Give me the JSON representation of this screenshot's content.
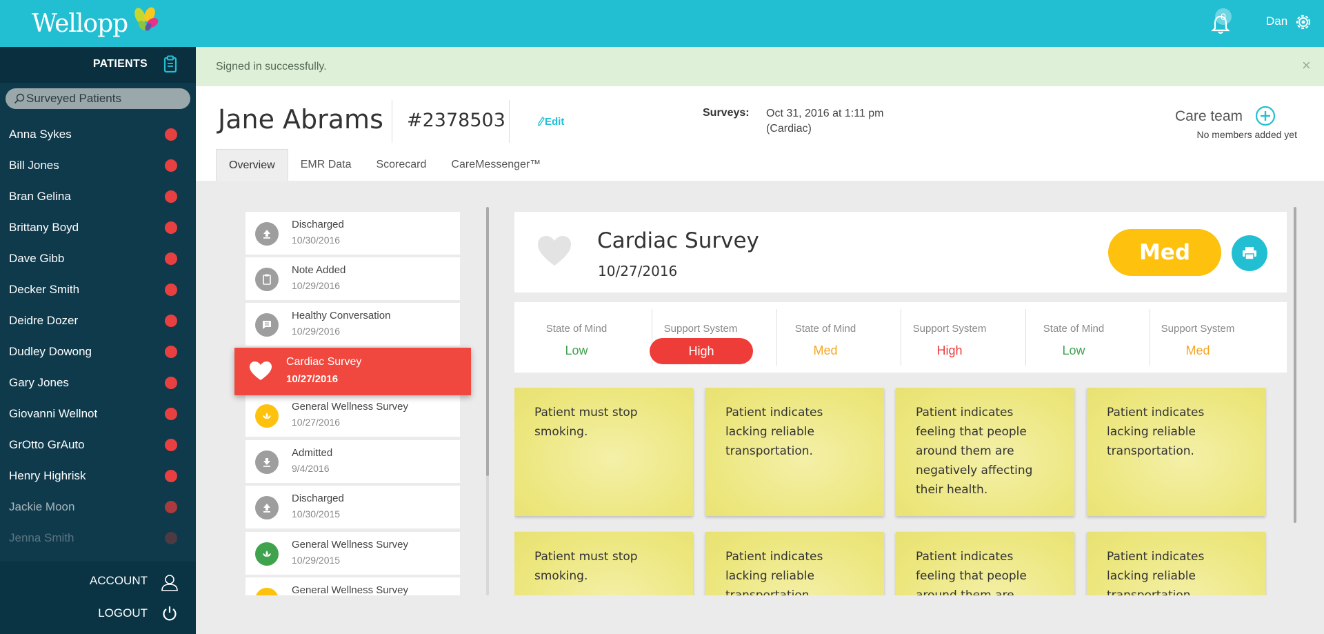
{
  "app": {
    "name": "Wellopp",
    "notification_count": "0",
    "user_name": "Dan"
  },
  "sidebar": {
    "header_label": "PATIENTS",
    "search_placeholder": "Surveyed Patients",
    "patients": [
      {
        "name": "Anna Sykes"
      },
      {
        "name": "Bill Jones"
      },
      {
        "name": "Bran Gelina"
      },
      {
        "name": "Brittany Boyd"
      },
      {
        "name": "Dave Gibb"
      },
      {
        "name": "Decker Smith"
      },
      {
        "name": "Deidre Dozer"
      },
      {
        "name": "Dudley Dowong"
      },
      {
        "name": "Gary Jones"
      },
      {
        "name": "Giovanni Wellnot"
      },
      {
        "name": "GrOtto GrAuto"
      },
      {
        "name": "Henry Highrisk"
      },
      {
        "name": "Jackie Moon"
      },
      {
        "name": "Jenna Smith"
      }
    ],
    "account_label": "ACCOUNT",
    "logout_label": "LOGOUT"
  },
  "alert": {
    "message": "Signed in successfully.",
    "close_symbol": "×"
  },
  "patient": {
    "name": "Jane Abrams",
    "id": "#2378503",
    "edit_label": "Edit",
    "surveys_label": "Surveys:",
    "surveys_date": "Oct 31, 2016 at 1:11 pm",
    "surveys_type": "(Cardiac)",
    "care_team_label": "Care team",
    "care_team_sub": "No members added yet"
  },
  "tabs": [
    {
      "label": "Overview"
    },
    {
      "label": "EMR Data"
    },
    {
      "label": "Scorecard"
    },
    {
      "label": "CareMessenger™"
    }
  ],
  "timeline": [
    {
      "title": "Discharged",
      "date": "10/30/2016",
      "icon": "upload-icon",
      "color": "#9e9e9e"
    },
    {
      "title": "Note Added",
      "date": "10/29/2016",
      "icon": "clipboard-icon",
      "color": "#9e9e9e"
    },
    {
      "title": "Healthy Conversation",
      "date": "10/29/2016",
      "icon": "chat-icon",
      "color": "#9e9e9e"
    },
    {
      "title": "Cardiac Survey",
      "date": "10/27/2016",
      "icon": "heart-icon",
      "color": "#f0483e"
    },
    {
      "title": "General Wellness Survey",
      "date": "10/27/2016",
      "icon": "lotus-icon",
      "color": "#fec10e"
    },
    {
      "title": "Admitted",
      "date": "9/4/2016",
      "icon": "download-icon",
      "color": "#9e9e9e"
    },
    {
      "title": "Discharged",
      "date": "10/30/2015",
      "icon": "upload-icon",
      "color": "#9e9e9e"
    },
    {
      "title": "General Wellness Survey",
      "date": "10/29/2015",
      "icon": "lotus-icon",
      "color": "#3fa34d"
    },
    {
      "title": "General Wellness Survey",
      "date": "",
      "icon": "lotus-icon",
      "color": "#fec10e"
    }
  ],
  "survey": {
    "title": "Cardiac Survey",
    "date": "10/27/2016",
    "risk": "Med",
    "metrics": [
      {
        "label": "State of Mind",
        "value": "Low",
        "level": "low"
      },
      {
        "label": "Support System",
        "value": "High",
        "level": "high-pill"
      },
      {
        "label": "State of Mind",
        "value": "Med",
        "level": "med"
      },
      {
        "label": "Support System",
        "value": "High",
        "level": "high"
      },
      {
        "label": "State of Mind",
        "value": "Low",
        "level": "low"
      },
      {
        "label": "Support System",
        "value": "Med",
        "level": "med"
      }
    ],
    "notes": [
      "Patient must stop smoking.",
      "Patient indicates lacking reliable transportation.",
      "Patient indicates feeling that people around them are negatively affecting their health.",
      "Patient indicates lacking reliable transportation.",
      "Patient must stop smoking.",
      "Patient indicates lacking reliable transportation.",
      "Patient indicates feeling that people around them are negatively affecting their health.",
      "Patient indicates lacking reliable transportation."
    ]
  },
  "colors": {
    "brand": "#22bfd3",
    "sidebar": "#0e3a4c",
    "alert_red": "#f0483e",
    "risk_med": "#fec10e"
  }
}
